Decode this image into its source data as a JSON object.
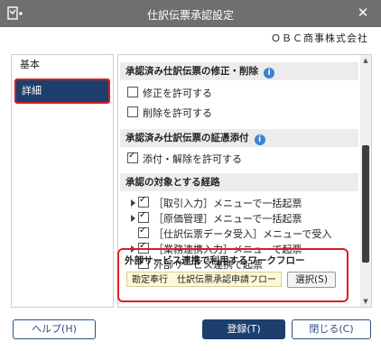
{
  "window": {
    "title": "仕訳伝票承認設定",
    "close_glyph": "✕"
  },
  "company": "ＯＢＣ商事株式会社",
  "sidebar": {
    "items": [
      {
        "label": "基本"
      },
      {
        "label": "詳細"
      }
    ]
  },
  "sections": [
    {
      "title": "承認済み仕訳伝票の修正・削除",
      "info": "i",
      "options": [
        {
          "label": "修正を許可する",
          "checked": false
        },
        {
          "label": "削除を許可する",
          "checked": false
        }
      ]
    },
    {
      "title": "承認済み仕訳伝票の証憑添付",
      "info": "i",
      "options": [
        {
          "label": "添付・解除を許可する",
          "checked": true
        }
      ]
    },
    {
      "title": "承認の対象とする経路",
      "options": [
        {
          "label": "［取引入力］メニューで一括起票",
          "checked": true,
          "expandable": true
        },
        {
          "label": "［原価管理］メニューで一括起票",
          "checked": true,
          "expandable": true
        },
        {
          "label": "［仕訳伝票データ受入］メニューで受入",
          "checked": true,
          "expandable": false
        },
        {
          "label": "［業務連携入力］メニューで起票",
          "checked": true,
          "expandable": true
        },
        {
          "label": "外部サービス連携で起票",
          "checked": true,
          "expandable": false
        }
      ]
    }
  ],
  "workflow": {
    "title": "外部サービス連携で利用するワークフロー",
    "value": "勘定奉行　仕訳伝票承認申請フロー",
    "select_label": "選択(S)"
  },
  "footer": {
    "help_label": "ヘルプ(H)",
    "register_label": "登録(T)",
    "close_label": "閉じる(C)"
  }
}
